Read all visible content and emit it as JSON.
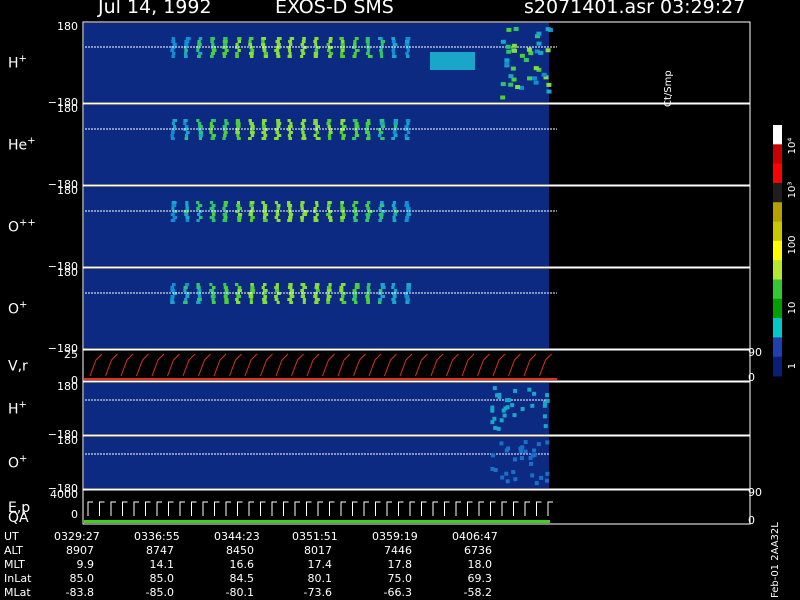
{
  "header": {
    "date": "Jul 14, 1992",
    "instrument": "EXOS-D SMS",
    "file": "s2071401.asr",
    "time": "03:29:27"
  },
  "chart_data": {
    "type": "heatmap",
    "panels": [
      {
        "label": "H",
        "sup": "+",
        "ticks": [
          "180",
          "−180"
        ]
      },
      {
        "label": "He",
        "sup": "+",
        "ticks": [
          "180",
          "−180"
        ]
      },
      {
        "label": "O",
        "sup": "++",
        "ticks": [
          "180",
          "−180"
        ]
      },
      {
        "label": "O",
        "sup": "+",
        "ticks": [
          "180",
          "−180"
        ]
      },
      {
        "label": "V,r",
        "sup": "",
        "ticks": [
          "25",
          "0"
        ],
        "right_ticks": [
          "90",
          "0"
        ]
      },
      {
        "label": "H",
        "sup": "+",
        "ticks": [
          "180",
          "−180"
        ]
      },
      {
        "label": "O",
        "sup": "+",
        "ticks": [
          "180",
          "−180"
        ]
      },
      {
        "label": "E,p",
        "sup": "",
        "label2": "QA",
        "ticks": [
          "4000",
          "0"
        ],
        "right_ticks": [
          "90",
          "0"
        ]
      }
    ],
    "colorbar": {
      "title": "Ct/Smp",
      "ticks": [
        "10⁴",
        "10³",
        "100",
        "10",
        "1"
      ],
      "colors": [
        "#ffffff",
        "#c80000",
        "#ff0000",
        "#1e1e1e",
        "#b4a000",
        "#c8c800",
        "#ffff00",
        "#b4e632",
        "#32c832",
        "#00a000",
        "#00c8c8",
        "#2040b0",
        "#0a1e78"
      ]
    },
    "table": {
      "rows": [
        {
          "label": "UT",
          "values": [
            "0329:27",
            "0336:55",
            "0344:23",
            "0351:51",
            "0359:19",
            "0406:47"
          ]
        },
        {
          "label": "ALT",
          "values": [
            "8907",
            "8747",
            "8450",
            "8017",
            "7446",
            "6736"
          ]
        },
        {
          "label": "MLT",
          "values": [
            "9.9",
            "14.1",
            "16.6",
            "17.4",
            "17.8",
            "18.0"
          ]
        },
        {
          "label": "InLat",
          "values": [
            "85.0",
            "85.0",
            "84.5",
            "80.1",
            "75.0",
            "69.3"
          ]
        },
        {
          "label": "MLat",
          "values": [
            "-83.8",
            "-85.0",
            "-80.1",
            "-73.6",
            "-66.3",
            "-58.2"
          ]
        }
      ]
    },
    "footer": "Feb-01 2AA32L"
  }
}
